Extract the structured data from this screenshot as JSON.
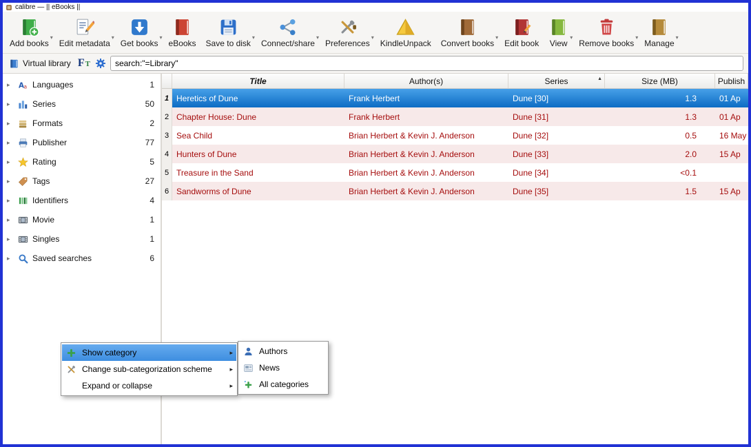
{
  "window": {
    "title": "calibre — || eBooks ||"
  },
  "colors": {
    "window_border": "#2132d4",
    "toolbar_bg": "#f6f5f3",
    "selection_top": "#47a0e8",
    "selection_bottom": "#0d6cc4",
    "row_alt": "#f7e9e9",
    "row_text": "#a50d0d",
    "menu_highlight_top": "#66abee",
    "menu_highlight_bottom": "#3e8ee0"
  },
  "toolbar": {
    "items": [
      {
        "label": "Add books",
        "icon": "add-books-icon",
        "dropdown": true
      },
      {
        "label": "Edit metadata",
        "icon": "edit-metadata-icon",
        "dropdown": true
      },
      {
        "label": "Get books",
        "icon": "get-books-icon",
        "dropdown": true
      },
      {
        "label": "eBooks",
        "icon": "ebooks-icon",
        "dropdown": false
      },
      {
        "label": "Save to disk",
        "icon": "save-to-disk-icon",
        "dropdown": true
      },
      {
        "label": "Connect/share",
        "icon": "connect-share-icon",
        "dropdown": true
      },
      {
        "label": "Preferences",
        "icon": "preferences-icon",
        "dropdown": true
      },
      {
        "label": "KindleUnpack",
        "icon": "kindleunpack-icon",
        "dropdown": false
      },
      {
        "label": "Convert books",
        "icon": "convert-books-icon",
        "dropdown": true
      },
      {
        "label": "Edit book",
        "icon": "edit-book-icon",
        "dropdown": false
      },
      {
        "label": "View",
        "icon": "view-icon",
        "dropdown": true
      },
      {
        "label": "Remove books",
        "icon": "remove-books-icon",
        "dropdown": true
      },
      {
        "label": "Manage",
        "icon": "manage-icon",
        "dropdown": true
      }
    ]
  },
  "search_row": {
    "virtual_library_label": "Virtual library",
    "ft_f": "F",
    "ft_t": "T",
    "search_value": "search:\"=Library\""
  },
  "sidebar": {
    "items": [
      {
        "label": "Languages",
        "count": "1",
        "icon": "languages-icon"
      },
      {
        "label": "Series",
        "count": "50",
        "icon": "series-icon"
      },
      {
        "label": "Formats",
        "count": "2",
        "icon": "formats-icon"
      },
      {
        "label": "Publisher",
        "count": "77",
        "icon": "publisher-icon"
      },
      {
        "label": "Rating",
        "count": "5",
        "icon": "rating-icon"
      },
      {
        "label": "Tags",
        "count": "27",
        "icon": "tags-icon"
      },
      {
        "label": "Identifiers",
        "count": "4",
        "icon": "identifiers-icon"
      },
      {
        "label": "Movie",
        "count": "1",
        "icon": "movie-icon"
      },
      {
        "label": "Singles",
        "count": "1",
        "icon": "singles-icon"
      },
      {
        "label": "Saved searches",
        "count": "6",
        "icon": "saved-searches-icon"
      }
    ]
  },
  "table": {
    "columns": [
      {
        "label": "Title",
        "emphasized": true
      },
      {
        "label": "Author(s)"
      },
      {
        "label": "Series",
        "sorted": "asc"
      },
      {
        "label": "Size (MB)"
      },
      {
        "label": "Publish"
      }
    ],
    "rows": [
      {
        "num": "1",
        "title": "Heretics of Dune",
        "authors": "Frank Herbert",
        "series": "Dune [30]",
        "size": "1.3",
        "published": "01 Ap",
        "selected": true
      },
      {
        "num": "2",
        "title": "Chapter House: Dune",
        "authors": "Frank Herbert",
        "series": "Dune [31]",
        "size": "1.3",
        "published": "01 Ap"
      },
      {
        "num": "3",
        "title": "Sea Child",
        "authors": "Brian Herbert & Kevin J. Anderson",
        "series": "Dune [32]",
        "size": "0.5",
        "published": "16 May"
      },
      {
        "num": "4",
        "title": "Hunters of Dune",
        "authors": "Brian Herbert & Kevin J. Anderson",
        "series": "Dune [33]",
        "size": "2.0",
        "published": "15 Ap"
      },
      {
        "num": "5",
        "title": "Treasure in the Sand",
        "authors": "Brian Herbert & Kevin J. Anderson",
        "series": "Dune [34]",
        "size": "<0.1",
        "published": ""
      },
      {
        "num": "6",
        "title": "Sandworms of Dune",
        "authors": "Brian Herbert & Kevin J. Anderson",
        "series": "Dune [35]",
        "size": "1.5",
        "published": "15 Ap"
      }
    ]
  },
  "context_menu": {
    "items": [
      {
        "label": "Show category",
        "icon": "show-category-icon",
        "submenu": true,
        "highlighted": true
      },
      {
        "label": "Change sub-categorization scheme",
        "icon": "tools-icon",
        "submenu": true
      },
      {
        "label": "Expand or collapse",
        "icon": null,
        "submenu": true
      }
    ],
    "submenu_items": [
      {
        "label": "Authors",
        "icon": "authors-icon"
      },
      {
        "label": "News",
        "icon": "news-icon"
      },
      {
        "label": "All categories",
        "icon": "all-categories-icon"
      }
    ]
  }
}
